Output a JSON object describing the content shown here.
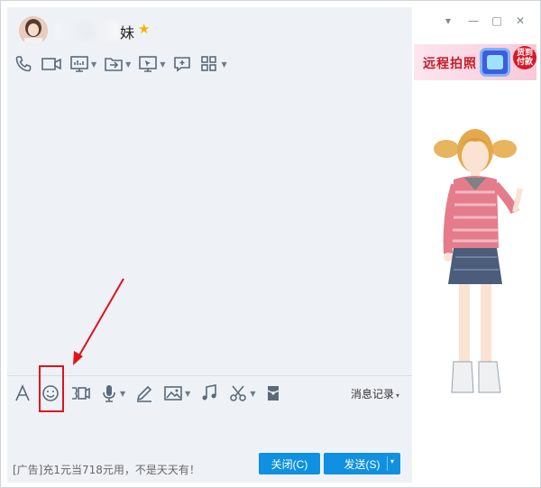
{
  "window": {
    "contact_name_suffix": "妹",
    "vip_star": "★",
    "controls": {
      "dropdown": "▾",
      "minimize": "—",
      "maximize": "□",
      "close": "✕"
    }
  },
  "top_toolbar": [
    {
      "icon": "phone-icon",
      "has_caret": false
    },
    {
      "icon": "video-call-icon",
      "has_caret": false
    },
    {
      "icon": "screen-share-icon",
      "has_caret": true
    },
    {
      "icon": "file-transfer-icon",
      "has_caret": true
    },
    {
      "icon": "remote-desktop-icon",
      "has_caret": true
    },
    {
      "icon": "add-chat-icon",
      "has_caret": false
    },
    {
      "icon": "apps-grid-icon",
      "has_caret": true
    }
  ],
  "ad_banner": {
    "title": "远程拍照",
    "badge": "货到付款"
  },
  "bottom_toolbar": [
    {
      "icon": "font-icon",
      "has_caret": false
    },
    {
      "icon": "emoji-icon",
      "has_caret": false
    },
    {
      "icon": "gif-icon",
      "has_caret": false
    },
    {
      "icon": "microphone-icon",
      "has_caret": true
    },
    {
      "icon": "pen-icon",
      "has_caret": false
    },
    {
      "icon": "image-icon",
      "has_caret": true
    },
    {
      "icon": "music-icon",
      "has_caret": false
    },
    {
      "icon": "scissors-icon",
      "has_caret": true
    },
    {
      "icon": "hongbao-icon",
      "has_caret": false
    }
  ],
  "history": {
    "label": "消息记录",
    "caret": "▾"
  },
  "footer": {
    "ad_text": "[广告]充1元当718元用，不是天天有！",
    "close_label": "关闭(C)",
    "send_label": "发送(S)",
    "send_caret": "▾"
  },
  "colors": {
    "accent": "#0f90e0",
    "annotation": "#e2111b",
    "chat_bg": "#eef2f7"
  }
}
